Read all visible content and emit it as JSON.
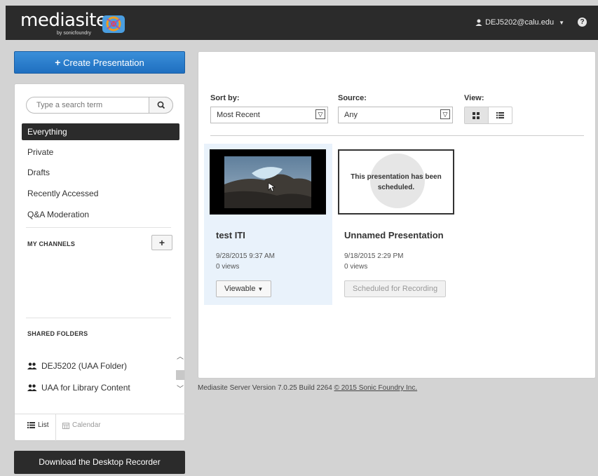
{
  "app": {
    "brand": "mediasite",
    "brand_sub": "by sonicfoundry",
    "user": "DEJ5202@calu.edu",
    "help_icon": "question-circle-icon"
  },
  "sidebar": {
    "create_label": "Create Presentation",
    "search_placeholder": "Type a search term",
    "nav": [
      "Everything",
      "Private",
      "Drafts",
      "Recently Accessed",
      "Q&A Moderation"
    ],
    "active_nav": "Everything",
    "my_channels_label": "MY CHANNELS",
    "shared_folders_label": "SHARED FOLDERS",
    "shared_folders": [
      "DEJ5202 (UAA Folder)",
      "UAA for Library Content"
    ],
    "view_list_label": "List",
    "view_calendar_label": "Calendar",
    "download_label": "Download the Desktop Recorder"
  },
  "controls": {
    "sort_label": "Sort by:",
    "sort_value": "Most Recent",
    "source_label": "Source:",
    "source_value": "Any",
    "view_label": "View:",
    "view_mode": "grid"
  },
  "presentations": [
    {
      "title": "test ITI",
      "date": "9/28/2015 9:37 AM",
      "views": "0 views",
      "status": "Viewable",
      "thumbnail": "video-frame"
    },
    {
      "title": "Unnamed Presentation",
      "date": "9/18/2015 2:29 PM",
      "views": "0 views",
      "status": "Scheduled for Recording",
      "placeholder_text": "This presentation has been scheduled."
    }
  ],
  "footer": {
    "version": "Mediasite Server Version 7.0.25 Build 2264",
    "copyright": "© 2015 Sonic Foundry Inc."
  },
  "colors": {
    "primary_blue": "#1f6fc0",
    "dark": "#2b2b2b",
    "selected_card": "#e9f2fb"
  }
}
